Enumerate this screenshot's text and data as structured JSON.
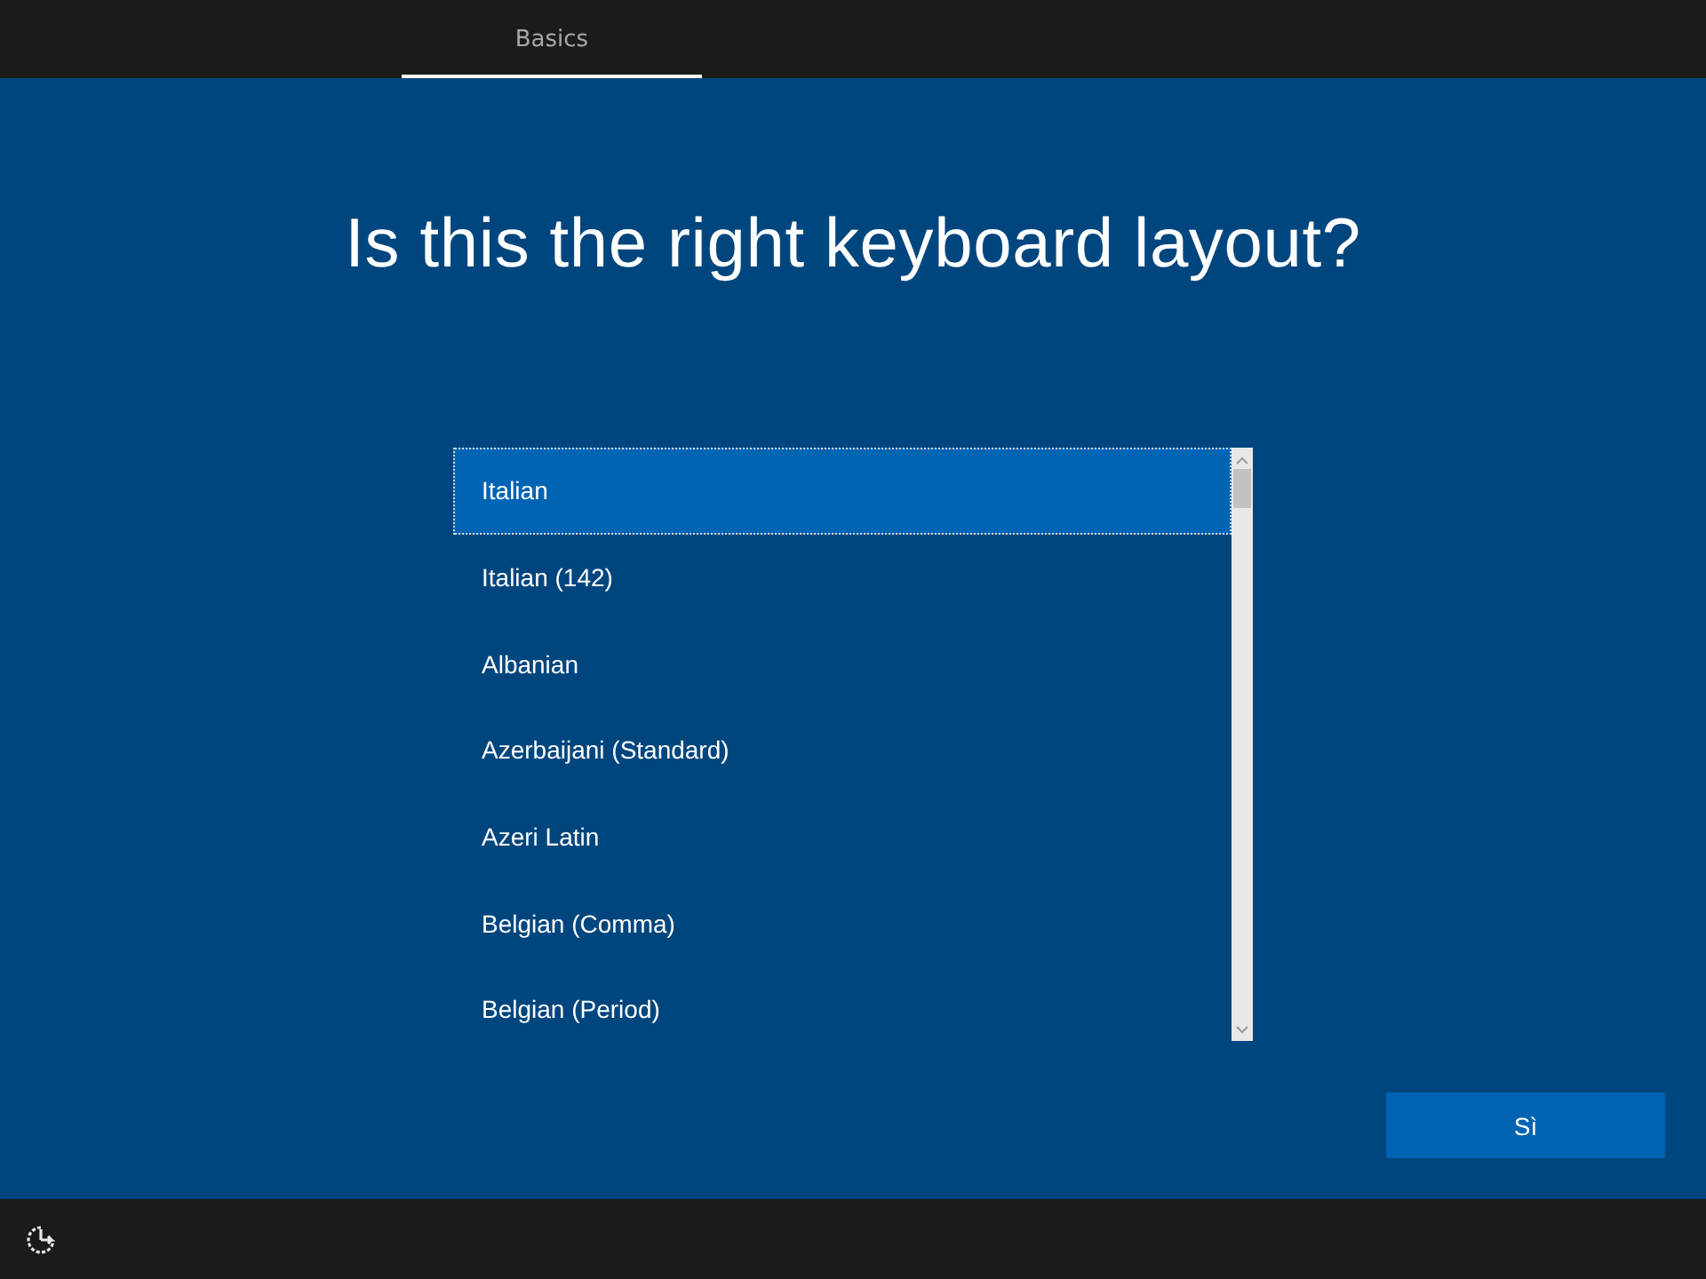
{
  "tabs": [
    {
      "label": "Basics",
      "selected": true
    }
  ],
  "title": "Is this the right keyboard layout?",
  "layouts": [
    {
      "label": "Italian",
      "selected": true
    },
    {
      "label": "Italian (142)",
      "selected": false
    },
    {
      "label": "Albanian",
      "selected": false
    },
    {
      "label": "Azerbaijani (Standard)",
      "selected": false
    },
    {
      "label": "Azeri Latin",
      "selected": false
    },
    {
      "label": "Belgian (Comma)",
      "selected": false
    },
    {
      "label": "Belgian (Period)",
      "selected": false
    }
  ],
  "confirm_button": "Sì"
}
